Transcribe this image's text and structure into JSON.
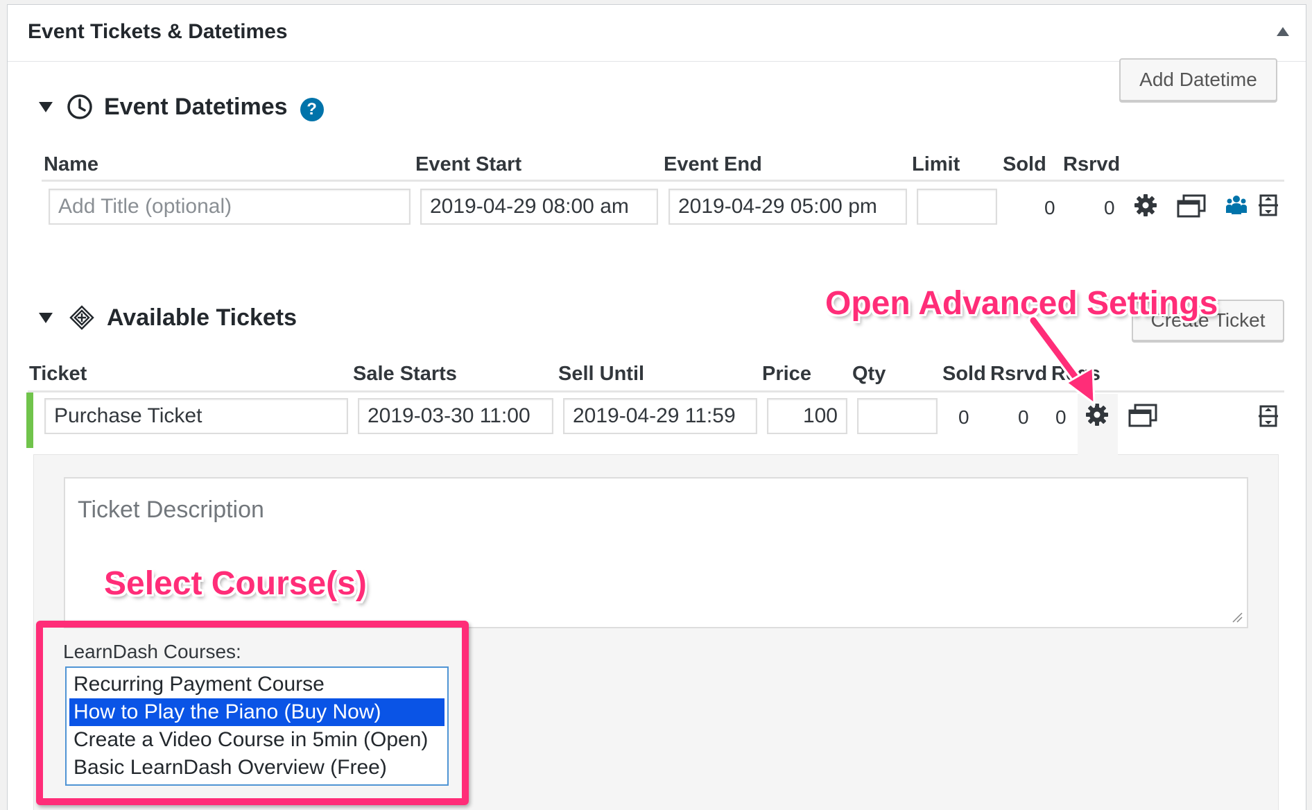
{
  "panel": {
    "title": "Event Tickets & Datetimes"
  },
  "datetimes": {
    "title": "Event Datetimes",
    "help_glyph": "?",
    "add_button": "Add Datetime",
    "columns": [
      "Name",
      "Event Start",
      "Event End",
      "Limit",
      "Sold",
      "Rsrvd"
    ],
    "row": {
      "name_placeholder": "Add Title (optional)",
      "start": "2019-04-29 08:00 am",
      "end": "2019-04-29 05:00 pm",
      "limit": "",
      "sold": "0",
      "rsrvd": "0"
    }
  },
  "tickets": {
    "title": "Available Tickets",
    "create_button": "Create Ticket",
    "columns": [
      "Ticket",
      "Sale Starts",
      "Sell Until",
      "Price",
      "Qty",
      "Sold",
      "Rsrvd",
      "Regs"
    ],
    "row": {
      "name": "Purchase Ticket",
      "sale_starts": "2019-03-30 11:00",
      "sell_until": "2019-04-29 11:59",
      "price": "100",
      "qty": "",
      "sold": "0",
      "rsrvd": "0",
      "regs": "0"
    },
    "description_placeholder": "Ticket Description",
    "learndash": {
      "label": "LearnDash Courses:",
      "options": [
        "Recurring Payment Course",
        "How to Play the Piano (Buy Now)",
        "Create a Video Course in 5min (Open)",
        "Basic LearnDash Overview (Free)"
      ],
      "selected_index": 1
    }
  },
  "annotations": {
    "advanced": "Open Advanced Settings",
    "courses": "Select Course(s)",
    "color": "#ff2d78"
  },
  "icons": {
    "collapse": "triangle-up-icon",
    "clock": "clock-icon",
    "tickets": "tickets-icon",
    "settings": "gear-icon",
    "clone": "clone-icon",
    "registrants": "people-icon",
    "trash": "trash-icon"
  },
  "colors": {
    "accent": "#0073aa",
    "ticket_bar": "#70c44b",
    "selected": "#0a54e6"
  }
}
